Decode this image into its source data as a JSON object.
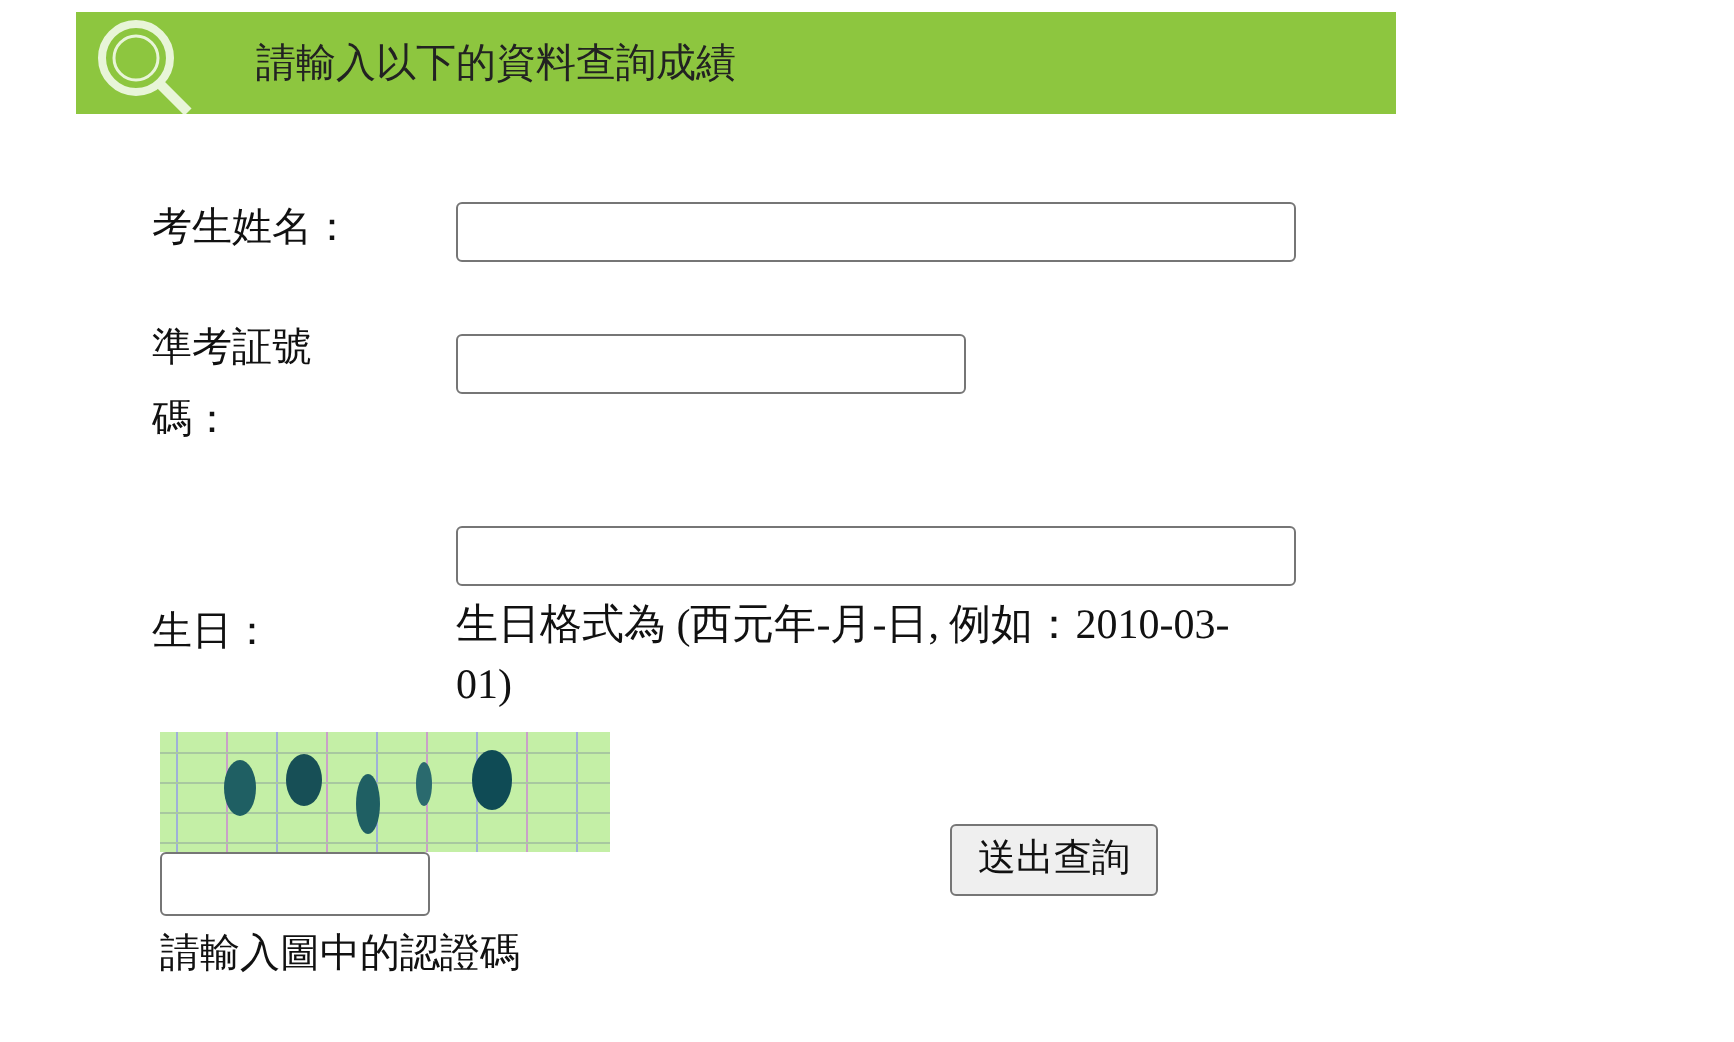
{
  "header": {
    "title": "請輸入以下的資料查詢成績"
  },
  "fields": [
    {
      "label": "考生姓名：",
      "kind": "wide"
    },
    {
      "label": "準考証號碼：",
      "kind": "short"
    },
    {
      "label": "生日：",
      "kind": "wide",
      "hint": "生日格式為 (西元年-月-日, 例如：2010-03-01)"
    }
  ],
  "captcha": {
    "kind": "picture",
    "caption": "請輸入圖中的認證碼"
  },
  "submit": {
    "label": "送出查詢"
  }
}
